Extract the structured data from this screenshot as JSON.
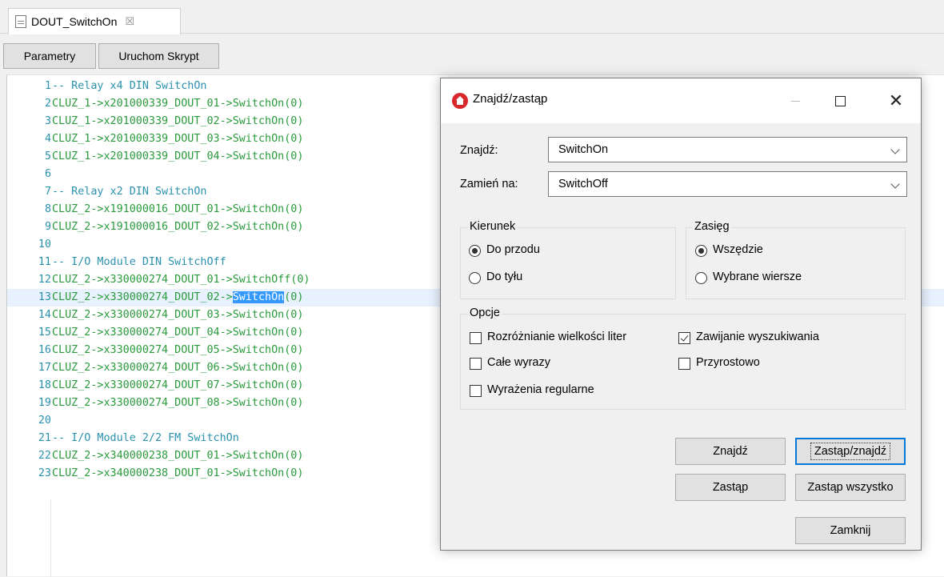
{
  "tab": {
    "title": "DOUT_SwitchOn",
    "close": "☒"
  },
  "toolbar": {
    "params": "Parametry",
    "run": "Uruchom Skrypt"
  },
  "editor": {
    "lines": [
      {
        "n": "1",
        "text": "-- Relay x4 DIN SwitchOn",
        "comment": true
      },
      {
        "n": "2",
        "text": "CLUZ_1->x201000339_DOUT_01->SwitchOn(0)"
      },
      {
        "n": "3",
        "text": "CLUZ_1->x201000339_DOUT_02->SwitchOn(0)"
      },
      {
        "n": "4",
        "text": "CLUZ_1->x201000339_DOUT_03->SwitchOn(0)"
      },
      {
        "n": "5",
        "text": "CLUZ_1->x201000339_DOUT_04->SwitchOn(0)"
      },
      {
        "n": "6",
        "text": ""
      },
      {
        "n": "7",
        "text": "-- Relay x2 DIN SwitchOn",
        "comment": true
      },
      {
        "n": "8",
        "text": "CLUZ_2->x191000016_DOUT_01->SwitchOn(0)"
      },
      {
        "n": "9",
        "text": "CLUZ_2->x191000016_DOUT_02->SwitchOn(0)"
      },
      {
        "n": "10",
        "text": ""
      },
      {
        "n": "11",
        "text": "-- I/O Module DIN SwitchOff",
        "comment": true
      },
      {
        "n": "12",
        "text": "CLUZ_2->x330000274_DOUT_01->SwitchOff(0)"
      },
      {
        "n": "13",
        "text_before": "CLUZ_2->x330000274_DOUT_02->",
        "match": "SwitchOn",
        "text_after": "(0)",
        "current": true
      },
      {
        "n": "14",
        "text": "CLUZ_2->x330000274_DOUT_03->SwitchOn(0)"
      },
      {
        "n": "15",
        "text": "CLUZ_2->x330000274_DOUT_04->SwitchOn(0)"
      },
      {
        "n": "16",
        "text": "CLUZ_2->x330000274_DOUT_05->SwitchOn(0)"
      },
      {
        "n": "17",
        "text": "CLUZ_2->x330000274_DOUT_06->SwitchOn(0)"
      },
      {
        "n": "18",
        "text": "CLUZ_2->x330000274_DOUT_07->SwitchOn(0)"
      },
      {
        "n": "19",
        "text": "CLUZ_2->x330000274_DOUT_08->SwitchOn(0)"
      },
      {
        "n": "20",
        "text": ""
      },
      {
        "n": "21",
        "text": "-- I/O Module 2/2 FM SwitchOn",
        "comment": true
      },
      {
        "n": "22",
        "text": "CLUZ_2->x340000238_DOUT_01->SwitchOn(0)"
      },
      {
        "n": "23",
        "text": "CLUZ_2->x340000238_DOUT_01->SwitchOn(0)"
      }
    ]
  },
  "dialog": {
    "title": "Znajdź/zastąp",
    "find_label": "Znajdź:",
    "find_value": "SwitchOn",
    "replace_label": "Zamień na:",
    "replace_value": "SwitchOff",
    "direction": {
      "title": "Kierunek",
      "forward": "Do przodu",
      "backward": "Do tyłu",
      "selected": "forward"
    },
    "scope": {
      "title": "Zasięg",
      "everywhere": "Wszędzie",
      "selected_lines": "Wybrane wiersze",
      "selected": "everywhere"
    },
    "options": {
      "title": "Opcje",
      "case_sensitive": {
        "label": "Rozróżnianie wielkości liter",
        "checked": false
      },
      "whole_words": {
        "label": "Całe wyrazy",
        "checked": false
      },
      "regex": {
        "label": "Wyrażenia regularne",
        "checked": false
      },
      "wrap_search": {
        "label": "Zawijanie wyszukiwania",
        "checked": true
      },
      "incremental": {
        "label": "Przyrostowo",
        "checked": false
      }
    },
    "buttons": {
      "find": "Znajdź",
      "replace_find": "Zastąp/znajdź",
      "replace": "Zastąp",
      "replace_all": "Zastąp wszystko",
      "close": "Zamknij"
    }
  },
  "colors": {
    "code_text": "#2a9a3c",
    "comment_text": "#2b91af",
    "line_numbers": "#2b91af",
    "match_highlight": "#3399ff",
    "current_line": "#e8f2fe",
    "default_button_border": "#0078d7",
    "app_icon": "#d8282b"
  }
}
